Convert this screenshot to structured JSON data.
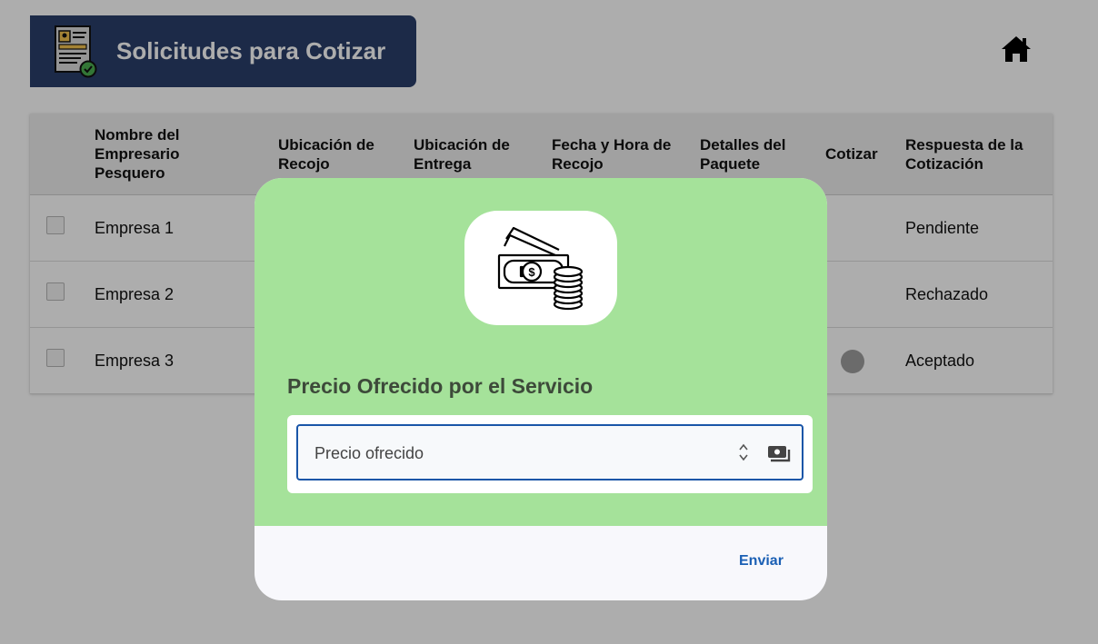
{
  "header": {
    "title": "Solicitudes para Cotizar"
  },
  "table": {
    "columns": [
      "Nombre del Empresario Pesquero",
      "Ubicación de Recojo",
      "Ubicación de Entrega",
      "Fecha y Hora de Recojo",
      "Detalles del Paquete",
      "Cotizar",
      "Respuesta de la Cotización"
    ],
    "rows": [
      {
        "name": "Empresa 1",
        "response": "Pendiente"
      },
      {
        "name": "Empresa 2",
        "response": "Rechazado"
      },
      {
        "name": "Empresa 3",
        "response": "Aceptado"
      }
    ]
  },
  "dialog": {
    "heading": "Precio Ofrecido por el Servicio",
    "input_placeholder": "Precio ofrecido",
    "input_value": "",
    "submit_label": "Enviar"
  },
  "icons": {
    "header": "certificate-document-icon",
    "home": "home-icon",
    "money": "money-cash-coins-icon",
    "field_adornment": "cash-icon"
  },
  "colors": {
    "header_bg": "#2a3f6a",
    "dialog_top": "#a5e29a",
    "accent": "#1a56a8"
  }
}
